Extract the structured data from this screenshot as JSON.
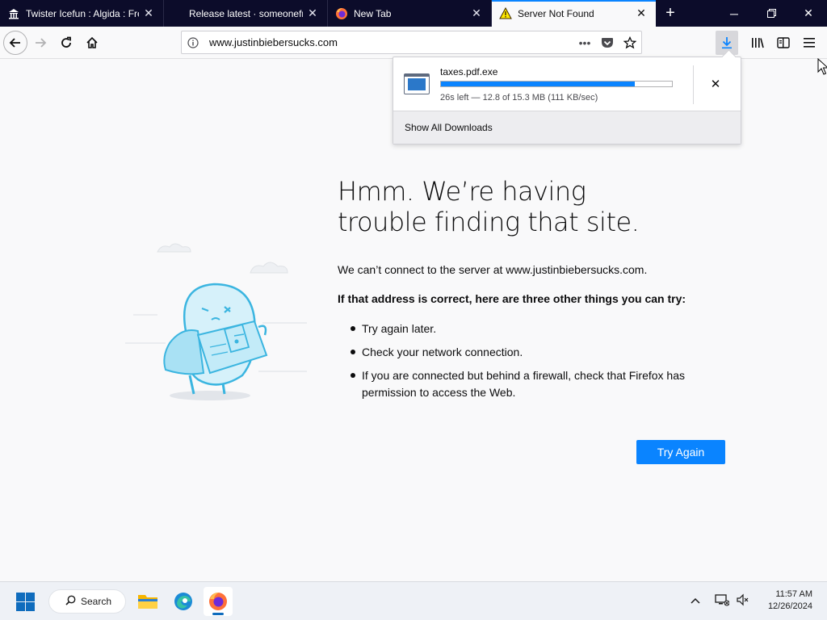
{
  "tabs": [
    {
      "title": "Twister Icefun : Algida : Fre",
      "favicon": "museum-icon",
      "active": false
    },
    {
      "title": "Release latest · someonefro",
      "favicon": "none",
      "active": false
    },
    {
      "title": "New Tab",
      "favicon": "firefox-icon",
      "active": false
    },
    {
      "title": "Server Not Found",
      "favicon": "warning-icon",
      "active": true
    }
  ],
  "navbar": {
    "url": "www.justinbiebersucks.com"
  },
  "downloads_panel": {
    "file_name": "taxes.pdf.exe",
    "progress": 0.84,
    "status": "26s left — 12.8 of 15.3 MB (111 KB/sec)",
    "show_all_label": "Show All Downloads"
  },
  "error_page": {
    "title": "Hmm. We’re having trouble finding that site.",
    "message": "We can’t connect to the server at www.justinbiebersucks.com.",
    "subheading": "If that address is correct, here are three other things you can try:",
    "suggestions": [
      "Try again later.",
      "Check your network connection.",
      "If you are connected but behind a firewall, check that Firefox has permission to access the Web."
    ],
    "try_again_label": "Try Again"
  },
  "taskbar": {
    "search_label": "Search",
    "time": "11:57 AM",
    "date": "12/26/2024"
  },
  "colors": {
    "accent": "#0a84ff",
    "tabstrip_bg": "#0c0c2a",
    "illustration_blue": "#3bb5e0"
  }
}
